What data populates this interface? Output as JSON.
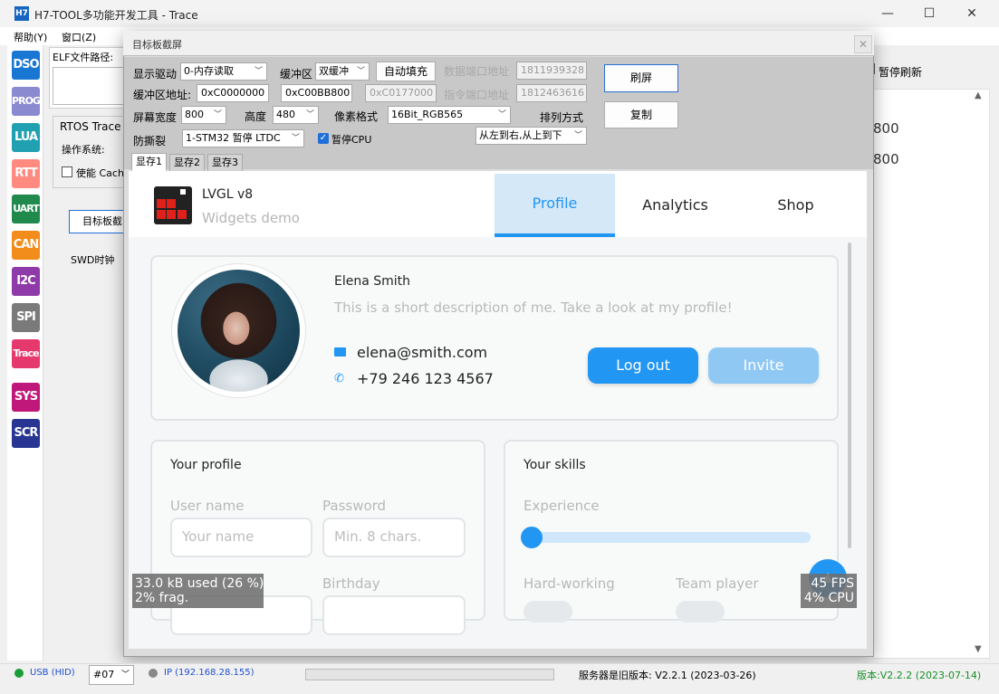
{
  "app": {
    "logo": "H7",
    "title": "H7-TOOL多功能开发工具 - Trace",
    "min_glyph": "—",
    "max_glyph": "☐",
    "close_glyph": "✕"
  },
  "menu": {
    "help": "帮助(Y)",
    "window": "窗口(Z)"
  },
  "toolbar": [
    {
      "label": "DSO",
      "color": "#1976d2"
    },
    {
      "label": "PROG",
      "color": "#8a8ad0"
    },
    {
      "label": "LUA",
      "color": "#20a0b0"
    },
    {
      "label": "RTT",
      "color": "#ff8a80"
    },
    {
      "label": "UART",
      "color": "#1f8a4c"
    },
    {
      "label": "CAN",
      "color": "#f28c1b"
    },
    {
      "label": "I2C",
      "color": "#8e3aa8"
    },
    {
      "label": "SPI",
      "color": "#7a7a7a"
    },
    {
      "label": "Trace",
      "color": "#e5396e"
    },
    {
      "label": "SYS",
      "color": "#c0187a"
    },
    {
      "label": "SCR",
      "color": "#283593"
    }
  ],
  "main": {
    "elf_label": "ELF文件路径:",
    "rtos_label": "RTOS Trace",
    "os_label": "操作系统:",
    "cache_label": "使能 Cach",
    "target_btn": "目标板截",
    "swd_label": "SWD时钟",
    "pause_refresh": "暂停刷新",
    "right_values": [
      "800",
      "800"
    ]
  },
  "dialog": {
    "title": "目标板截屏",
    "close": "✕",
    "display_driver_label": "显示驱动",
    "display_driver_value": "0-内存读取",
    "buffer_label": "缓冲区",
    "buffer_value": "双缓冲",
    "autofill_btn": "自动填充",
    "data_port_label": "数据端口地址",
    "data_port_value": "1811939328",
    "buffer_addr_label": "缓冲区地址:",
    "buffer_addr_1": "0xC0000000",
    "buffer_addr_2": "0xC00BB800",
    "buffer_addr_3": "0xC0177000",
    "cmd_port_label": "指令端口地址",
    "cmd_port_value": "1812463616",
    "width_label": "屏幕宽度",
    "width_value": "800",
    "height_label": "高度",
    "height_value": "480",
    "pixel_format_label": "像素格式",
    "pixel_format_value": "16Bit_RGB565",
    "order_label": "排列方式",
    "order_value": "从左到右,从上到下",
    "tearing_label": "防撕裂",
    "tearing_value": "1-STM32 暂停 LTDC",
    "pause_cpu_label": "暂停CPU",
    "refresh_btn": "刷屏",
    "copy_btn": "复制",
    "tabs": [
      "显存1",
      "显存2",
      "显存3"
    ]
  },
  "lvgl": {
    "title": "LVGL v8",
    "subtitle": "Widgets demo",
    "tabs": [
      "Profile",
      "Analytics",
      "Shop"
    ],
    "name": "Elena Smith",
    "description": "This is a short description of me. Take a look at my profile!",
    "email": "elena@smith.com",
    "phone": "+79 246 123 4567",
    "logout": "Log out",
    "invite": "Invite",
    "your_profile": "Your profile",
    "user_name_label": "User name",
    "user_name_placeholder": "Your name",
    "password_label": "Password",
    "password_placeholder": "Min. 8 chars.",
    "birthday_label": "Birthday",
    "your_skills": "Your skills",
    "experience_label": "Experience",
    "experience_value": 0,
    "hard_working_label": "Hard-working",
    "team_player_label": "Team player",
    "mem_line1": "33.0 kB used (26 %)",
    "mem_line2": "2% frag.",
    "fps_line1": "45 FPS",
    "fps_line2": "4% CPU",
    "fab_glyph": "▲"
  },
  "status": {
    "usb": "USB (HID)",
    "device": "#07",
    "ip": "IP (192.168.28.155)",
    "server_version": "服务器是旧版本: V2.2.1 (2023-03-26)",
    "version": "版本:V2.2.2 (2023-07-14)",
    "version_color": "#1a8f2a",
    "ip_color": "#1f4fd0"
  }
}
